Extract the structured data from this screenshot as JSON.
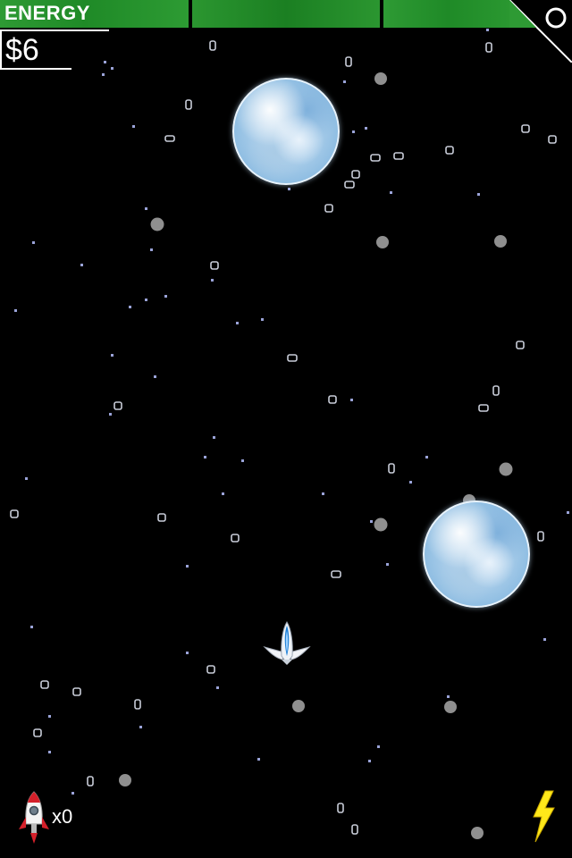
{
  "hud": {
    "energy_label": "ENERGY",
    "money": "$6",
    "rockets_count": "x0"
  },
  "icons": {
    "pause": "pause-circle-icon",
    "rocket": "rocket-icon",
    "power": "lightning-bolt-icon",
    "player": "spaceship-icon"
  },
  "colors": {
    "energy_green": "#2a9530",
    "background": "#000000",
    "bolt_yellow": "#ffe81a",
    "rocket_red": "#d4202a"
  }
}
